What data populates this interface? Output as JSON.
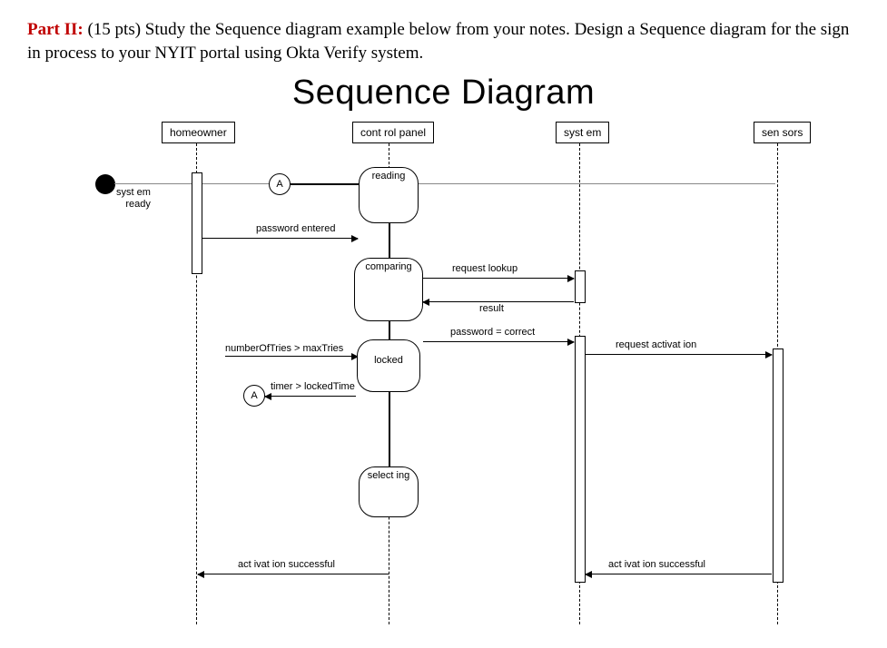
{
  "instructions": {
    "part_label": "Part II:",
    "text_after_label": " (15 pts) Study the Sequence diagram example below from your notes. Design a Sequence diagram for the sign in process to your NYIT portal using Okta Verify system."
  },
  "diagram": {
    "title": "Sequence Diagram",
    "lifelines": {
      "homeowner": "homeowner",
      "control_panel": "cont rol panel",
      "system": "syst em",
      "sensors": "sen sors"
    },
    "start_label": "syst em\nready",
    "states": {
      "reading": "reading",
      "comparing": "comparing",
      "locked": "locked",
      "selecting": "select ing"
    },
    "messages": {
      "password_entered": "password entered",
      "request_lookup": "request lookup",
      "result": "result",
      "password_correct": "password = correct",
      "number_of_tries": "numberOfTries > maxTries",
      "timer_locked": "timer > lockedTime",
      "request_activation": "request activat ion",
      "activation_successful_left": "act ivat ion successful",
      "activation_successful_right": "act ivat ion successful"
    },
    "connectors": {
      "A": "A"
    }
  }
}
